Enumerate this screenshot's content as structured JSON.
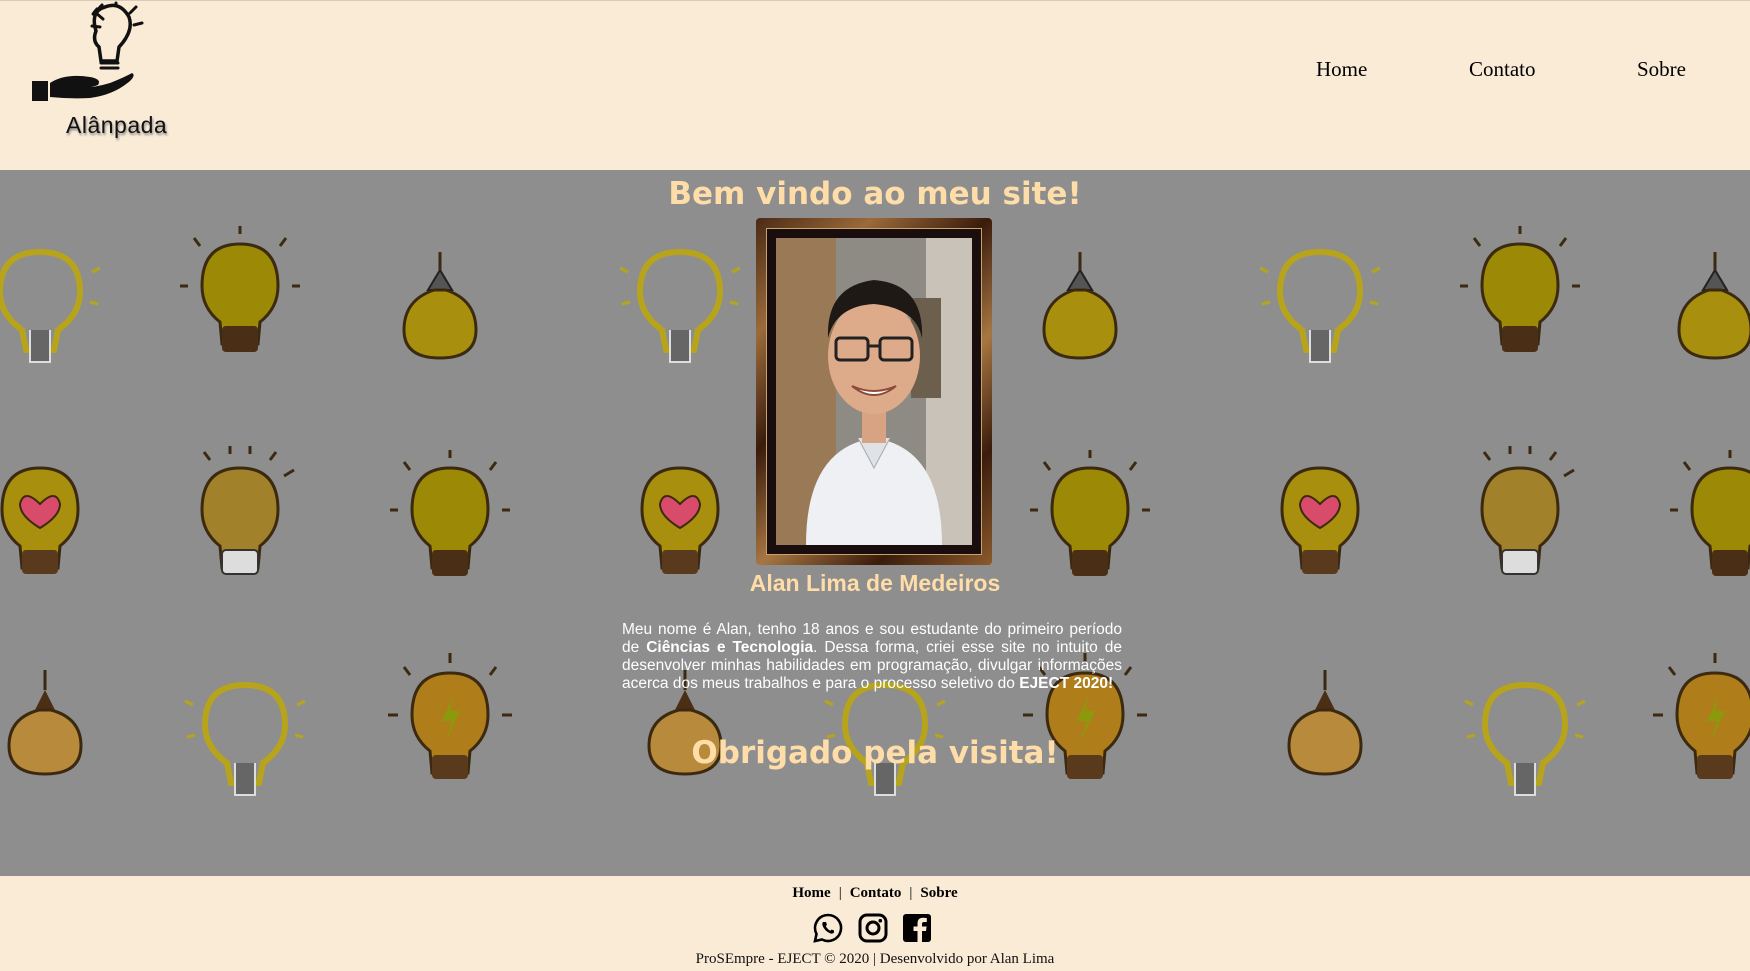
{
  "header": {
    "logo_text": "Alânpada",
    "nav": [
      "Home",
      "Contato",
      "Sobre"
    ]
  },
  "main": {
    "welcome_title": "Bem vindo ao meu site!",
    "name": "Alan Lima de Medeiros",
    "bio": {
      "part1": "Meu nome é Alan, tenho 18 anos e sou estudante do primeiro período de ",
      "course": "Ciências e Tecnologia",
      "part2": ". Dessa forma, criei esse site no intuito de desenvolver minhas habilidades em programação, divulgar informações acerca dos meus trabalhos e para o processo seletivo do ",
      "program": "EJECT 2020!"
    },
    "thanks_title": "Obrigado pela visita!"
  },
  "footer": {
    "nav": [
      "Home",
      "Contato",
      "Sobre"
    ],
    "separator": "|",
    "social_icons": [
      "whatsapp-icon",
      "instagram-icon",
      "facebook-icon"
    ],
    "copyright": "ProSEmpre - EJECT © 2020 | Desenvolvido por Alan Lima"
  },
  "colors": {
    "header_bg": "#faebd6",
    "main_bg": "#8e8e8e",
    "accent_text": "#ffdda8",
    "bulb_yellow": "#a8900e",
    "bulb_orange": "#b07d1b"
  }
}
